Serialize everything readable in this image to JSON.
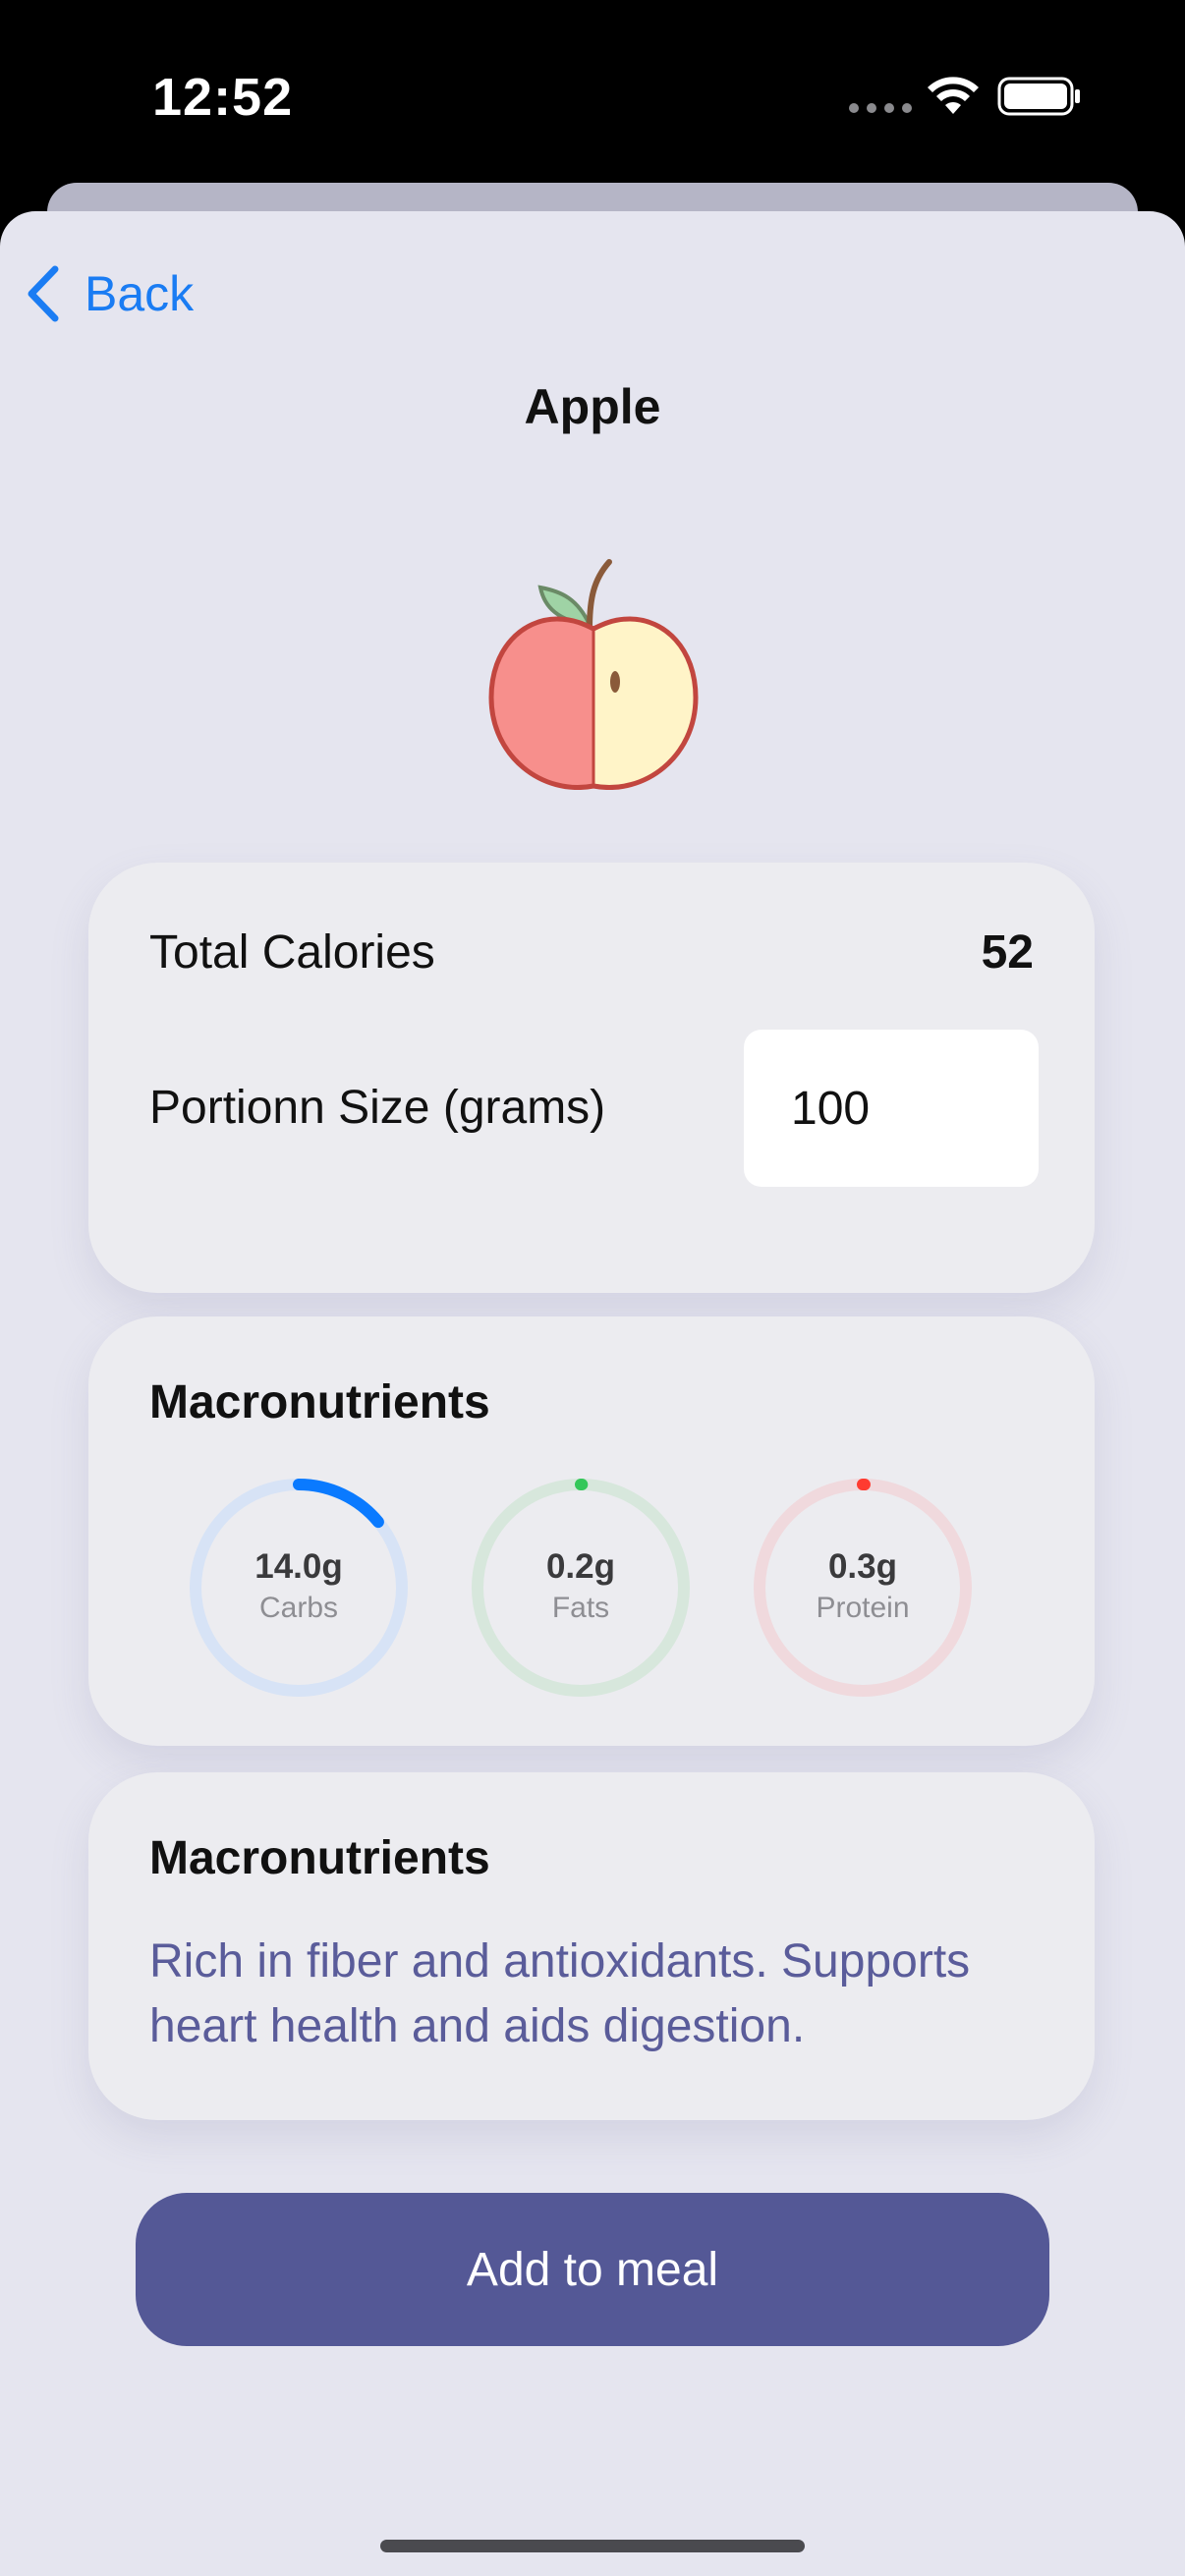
{
  "status_bar": {
    "time": "12:52",
    "icons": [
      "signal-dots-icon",
      "wifi-icon",
      "battery-icon"
    ]
  },
  "nav": {
    "back_label": "Back",
    "title": "Apple"
  },
  "food_icon": "apple-icon",
  "calories_card": {
    "total_label": "Total Calories",
    "total_value": "52",
    "portion_label": "Portionn Size (grams)",
    "portion_value": "100"
  },
  "macros_card": {
    "heading": "Macronutrients",
    "items": [
      {
        "value": "14.0g",
        "label": "Carbs",
        "color": "#0a7aff",
        "track_color": "#d7e3f6",
        "progress": 0.14
      },
      {
        "value": "0.2g",
        "label": "Fats",
        "color": "#34c759",
        "track_color": "#d7e7dc",
        "progress": 0.002
      },
      {
        "value": "0.3g",
        "label": "Protein",
        "color": "#ff3b30",
        "track_color": "#f0d9dd",
        "progress": 0.003
      }
    ]
  },
  "description_card": {
    "heading": "Macronutrients",
    "text": "Rich in fiber and antioxidants. Supports heart health and aids digestion."
  },
  "add_button_label": "Add to meal",
  "colors": {
    "accent": "#1a7cf3",
    "button": "#545896",
    "sheet_background": "#e5e5ef",
    "card_background": "#ececf0",
    "description_text": "#5a5c9a"
  }
}
